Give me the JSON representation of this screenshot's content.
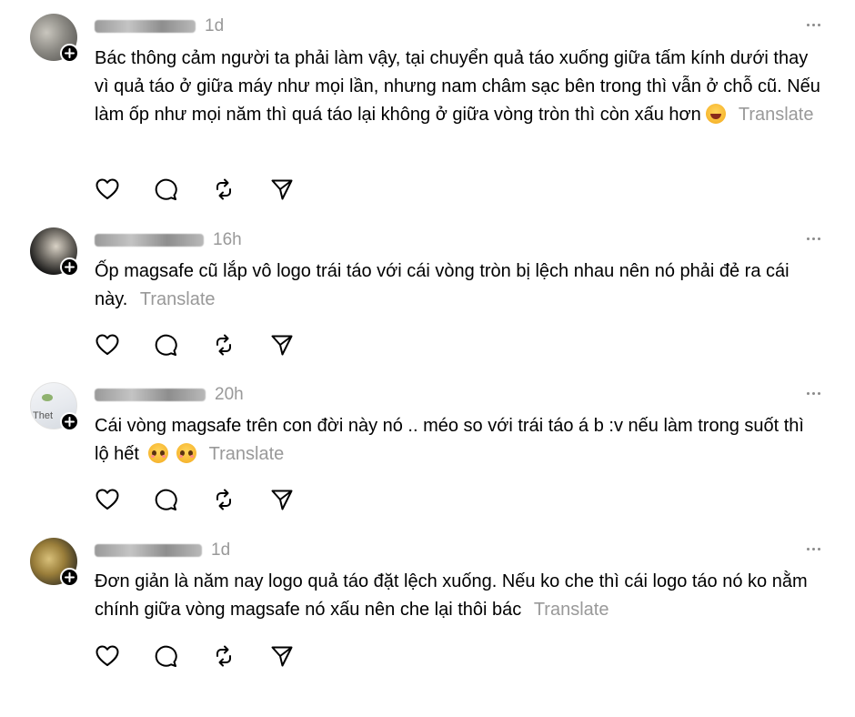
{
  "posts": [
    {
      "time": "1d",
      "text": "Bác thông cảm người ta phải làm vậy, tại chuyển quả táo xuống giữa tấm kính dưới thay vì quả táo ở giữa máy như mọi lần, nhưng nam châm sạc bên trong thì vẫn ở chỗ cũ. Nếu làm ốp như mọi năm thì quá táo lại không ở giữa vòng tròn thì còn xấu hơn",
      "emojis": [
        "grinning-sweat-emoji"
      ],
      "translate": "Translate"
    },
    {
      "time": "16h",
      "text": "Ốp magsafe cũ lắp vô logo trái táo với cái vòng tròn bị lệch nhau nên nó phải đẻ ra cái này.",
      "emojis": [],
      "translate": "Translate"
    },
    {
      "time": "20h",
      "avatar_text": "Thet",
      "text": "Cái vòng magsafe trên con đời này nó .. méo so với trái táo á b :v nếu làm trong suốt thì lộ hết",
      "emojis": [
        "pleading-face-emoji",
        "pleading-face-emoji"
      ],
      "translate": "Translate"
    },
    {
      "time": "1d",
      "text": "Đơn giản là năm nay logo quả táo đặt lệch xuống. Nếu ko che thì cái logo táo nó ko nằm chính giữa vòng magsafe nó xấu nên che lại thôi bác",
      "emojis": [],
      "translate": "Translate"
    }
  ],
  "icons": {
    "like": "heart-icon",
    "reply": "comment-icon",
    "repost": "repost-icon",
    "share": "share-icon",
    "more": "more-icon",
    "follow": "plus-icon"
  },
  "colors": {
    "text": "#000000",
    "muted": "#999999",
    "icon": "#000000"
  }
}
